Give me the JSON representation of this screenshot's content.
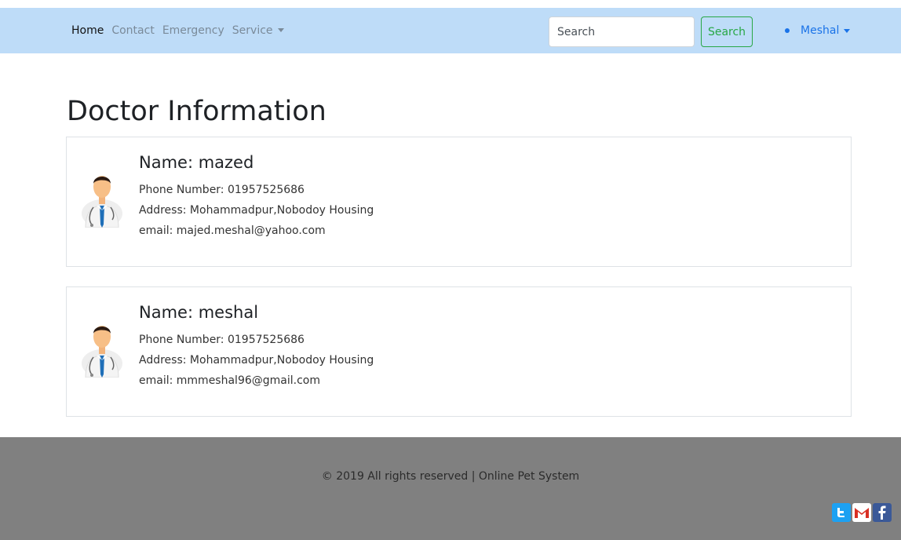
{
  "navbar": {
    "links": [
      "Home",
      "Contact",
      "Emergency",
      "Service"
    ],
    "search_placeholder": "Search",
    "search_button": "Search",
    "user": "Meshal"
  },
  "page_title": "Doctor Information",
  "doctors": [
    {
      "name": "Name: mazed",
      "phone": "Phone Number: 01957525686",
      "address": "Address: Mohammadpur,Nobodoy Housing",
      "email": "email: majed.meshal@yahoo.com"
    },
    {
      "name": "Name: meshal",
      "phone": "Phone Number: 01957525686",
      "address": "Address: Mohammadpur,Nobodoy Housing",
      "email": "email: mmmeshal96@gmail.com"
    }
  ],
  "footer": {
    "text": "© 2019 All rights reserved | Online Pet System",
    "social_icons": [
      "twitter-icon",
      "gmail-icon",
      "facebook-icon"
    ]
  },
  "colors": {
    "navbar_bg": "#bedcf8",
    "accent_green": "#28a745",
    "user_blue": "#1a73e8",
    "footer_bg": "#808080"
  }
}
